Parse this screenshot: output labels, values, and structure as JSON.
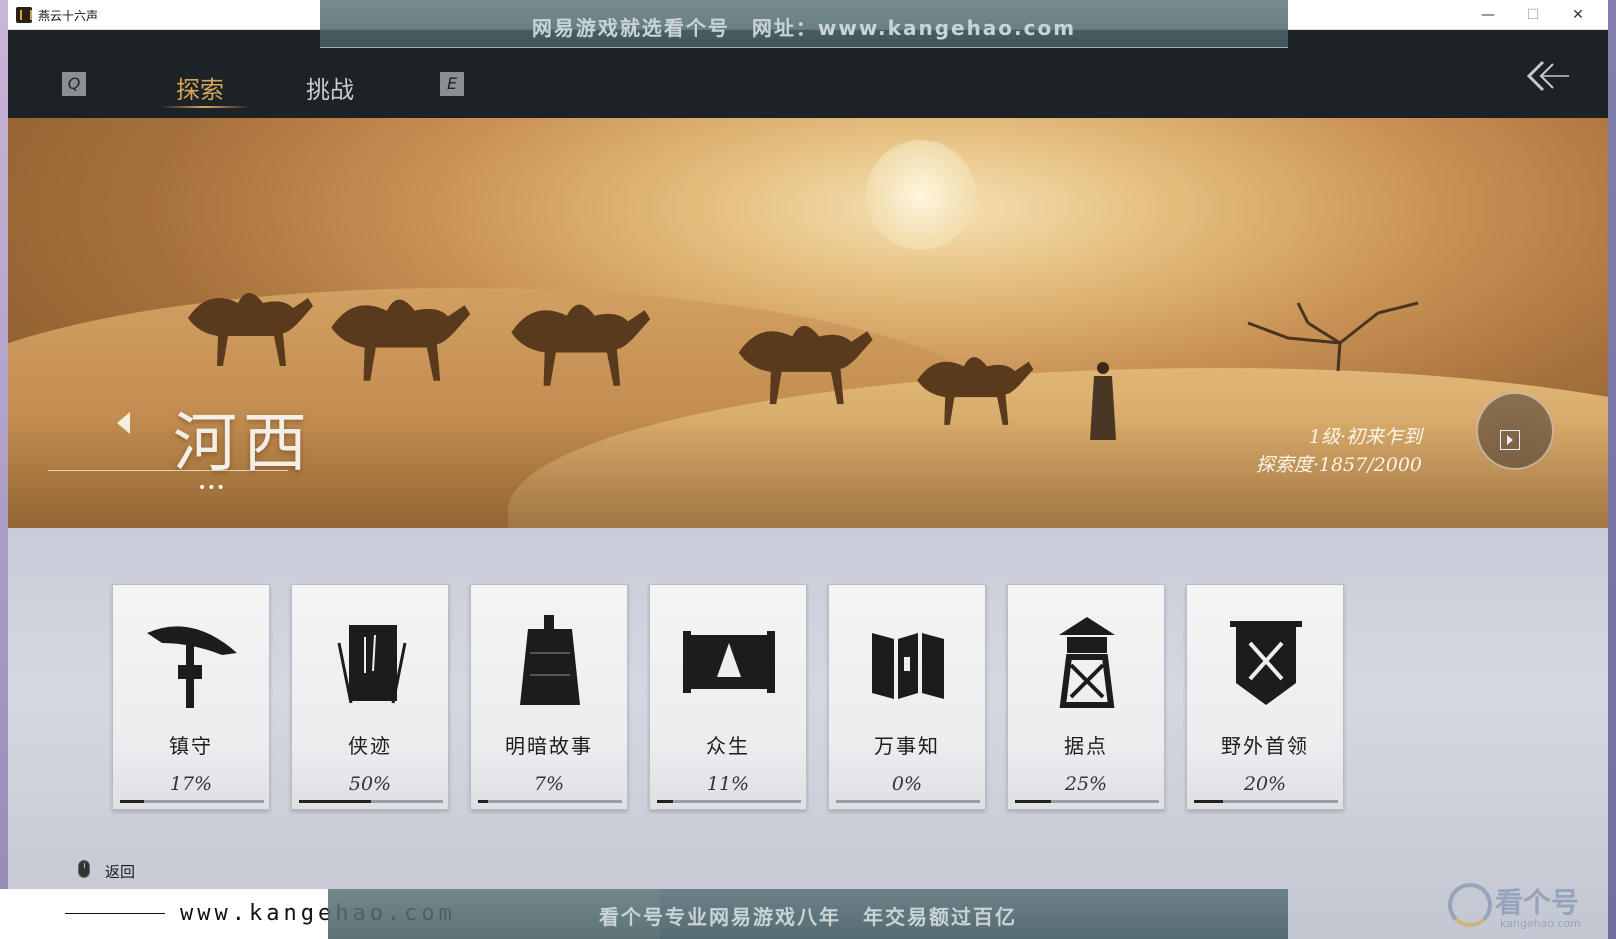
{
  "window": {
    "title": "燕云十六声",
    "min_glyph": "—",
    "max_glyph": "☐",
    "close_glyph": "✕"
  },
  "ad": {
    "top_text": "网易游戏就选看个号　网址：www.kangehao.com",
    "bottom_text": "看个号专业网易游戏八年　年交易额过百亿",
    "footer_url": "www.kangehao.com",
    "watermark_text": "看个号",
    "watermark_sub": "kangehao.com"
  },
  "header": {
    "key_left": "Q",
    "key_right": "E",
    "tabs": [
      {
        "label": "探索",
        "active": true
      },
      {
        "label": "挑战",
        "active": false
      }
    ]
  },
  "hero": {
    "region": "河西",
    "dots": "•••",
    "level": "1级·初来乍到",
    "explore": "探索度·1857/2000"
  },
  "cards": [
    {
      "label": "镇守",
      "percent": "17%",
      "progress": 0.17,
      "icon": "umbrella-hat-icon"
    },
    {
      "label": "侠迹",
      "percent": "50%",
      "progress": 0.5,
      "icon": "book-icon"
    },
    {
      "label": "明暗故事",
      "percent": "7%",
      "progress": 0.07,
      "icon": "bell-icon"
    },
    {
      "label": "众生",
      "percent": "11%",
      "progress": 0.11,
      "icon": "scroll-painting-icon"
    },
    {
      "label": "万事知",
      "percent": "0%",
      "progress": 0.0,
      "icon": "folding-screen-icon"
    },
    {
      "label": "据点",
      "percent": "25%",
      "progress": 0.25,
      "icon": "watchtower-icon"
    },
    {
      "label": "野外首领",
      "percent": "20%",
      "progress": 0.2,
      "icon": "crossed-swords-banner-icon"
    }
  ],
  "footer": {
    "back_label": "返回"
  }
}
